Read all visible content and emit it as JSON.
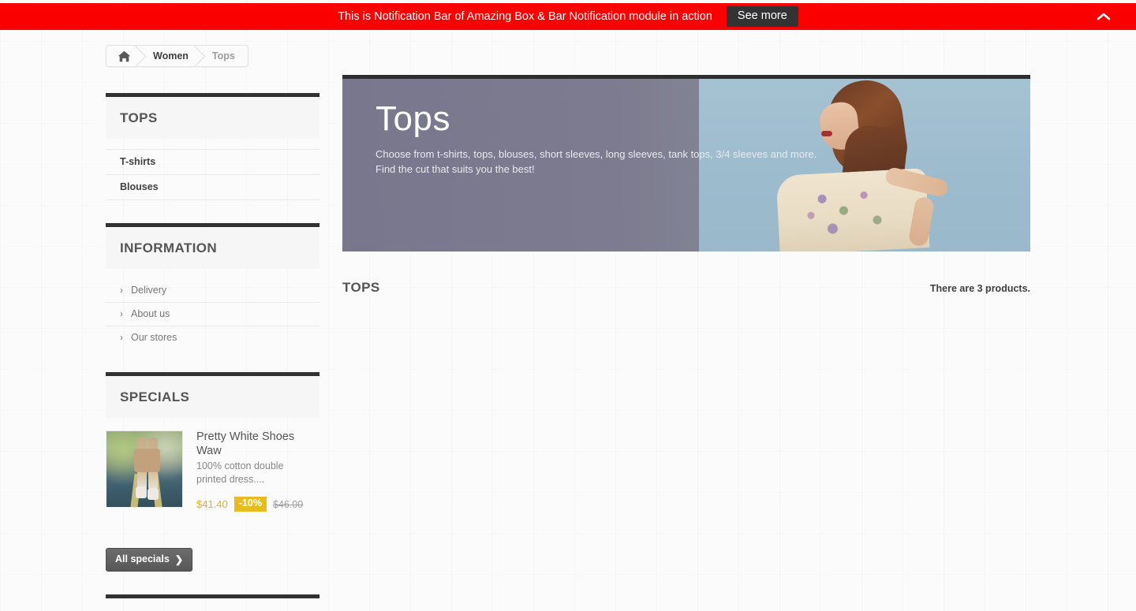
{
  "notification": {
    "message": "This is Notification Bar of Amazing Box & Bar Notification module in action",
    "button_label": "See more",
    "toggle_icon": "chevron-up-icon",
    "bar_color": "#fb0000",
    "button_color": "#333333"
  },
  "breadcrumb": {
    "home_icon": "home-icon",
    "items": [
      {
        "label": "Women"
      },
      {
        "label": "Tops"
      }
    ]
  },
  "sidebar": {
    "category_block": {
      "title": "TOPS",
      "items": [
        {
          "label": "T-shirts"
        },
        {
          "label": "Blouses"
        }
      ]
    },
    "information_block": {
      "title": "INFORMATION",
      "items": [
        {
          "label": "Delivery",
          "icon": "chevron-right-icon"
        },
        {
          "label": "About us",
          "icon": "chevron-right-icon"
        },
        {
          "label": "Our stores",
          "icon": "chevron-right-icon"
        }
      ]
    },
    "specials_block": {
      "title": "SPECIALS",
      "product": {
        "name": "Pretty White Shoes Waw",
        "description": "100% cotton double printed dress....",
        "price": "$41.40",
        "discount": "-10%",
        "old_price": "$46.00",
        "price_color": "#d9b526",
        "badge_color": "#e6bd1d",
        "image_alt": "pretty-white-shoes-thumbnail"
      },
      "all_specials_label": "All specials",
      "all_specials_icon": "chevron-right-icon"
    }
  },
  "main": {
    "banner": {
      "title": "Tops",
      "description_line1": "Choose from t-shirts, tops, blouses, short sleeves, long sleeves, tank tops, 3/4 sleeves and more.",
      "description_line2": "Find the cut that suits you the best!",
      "image_alt": "woman-in-floral-dress-banner"
    },
    "heading": "TOPS",
    "product_count": "There are 3 products."
  }
}
